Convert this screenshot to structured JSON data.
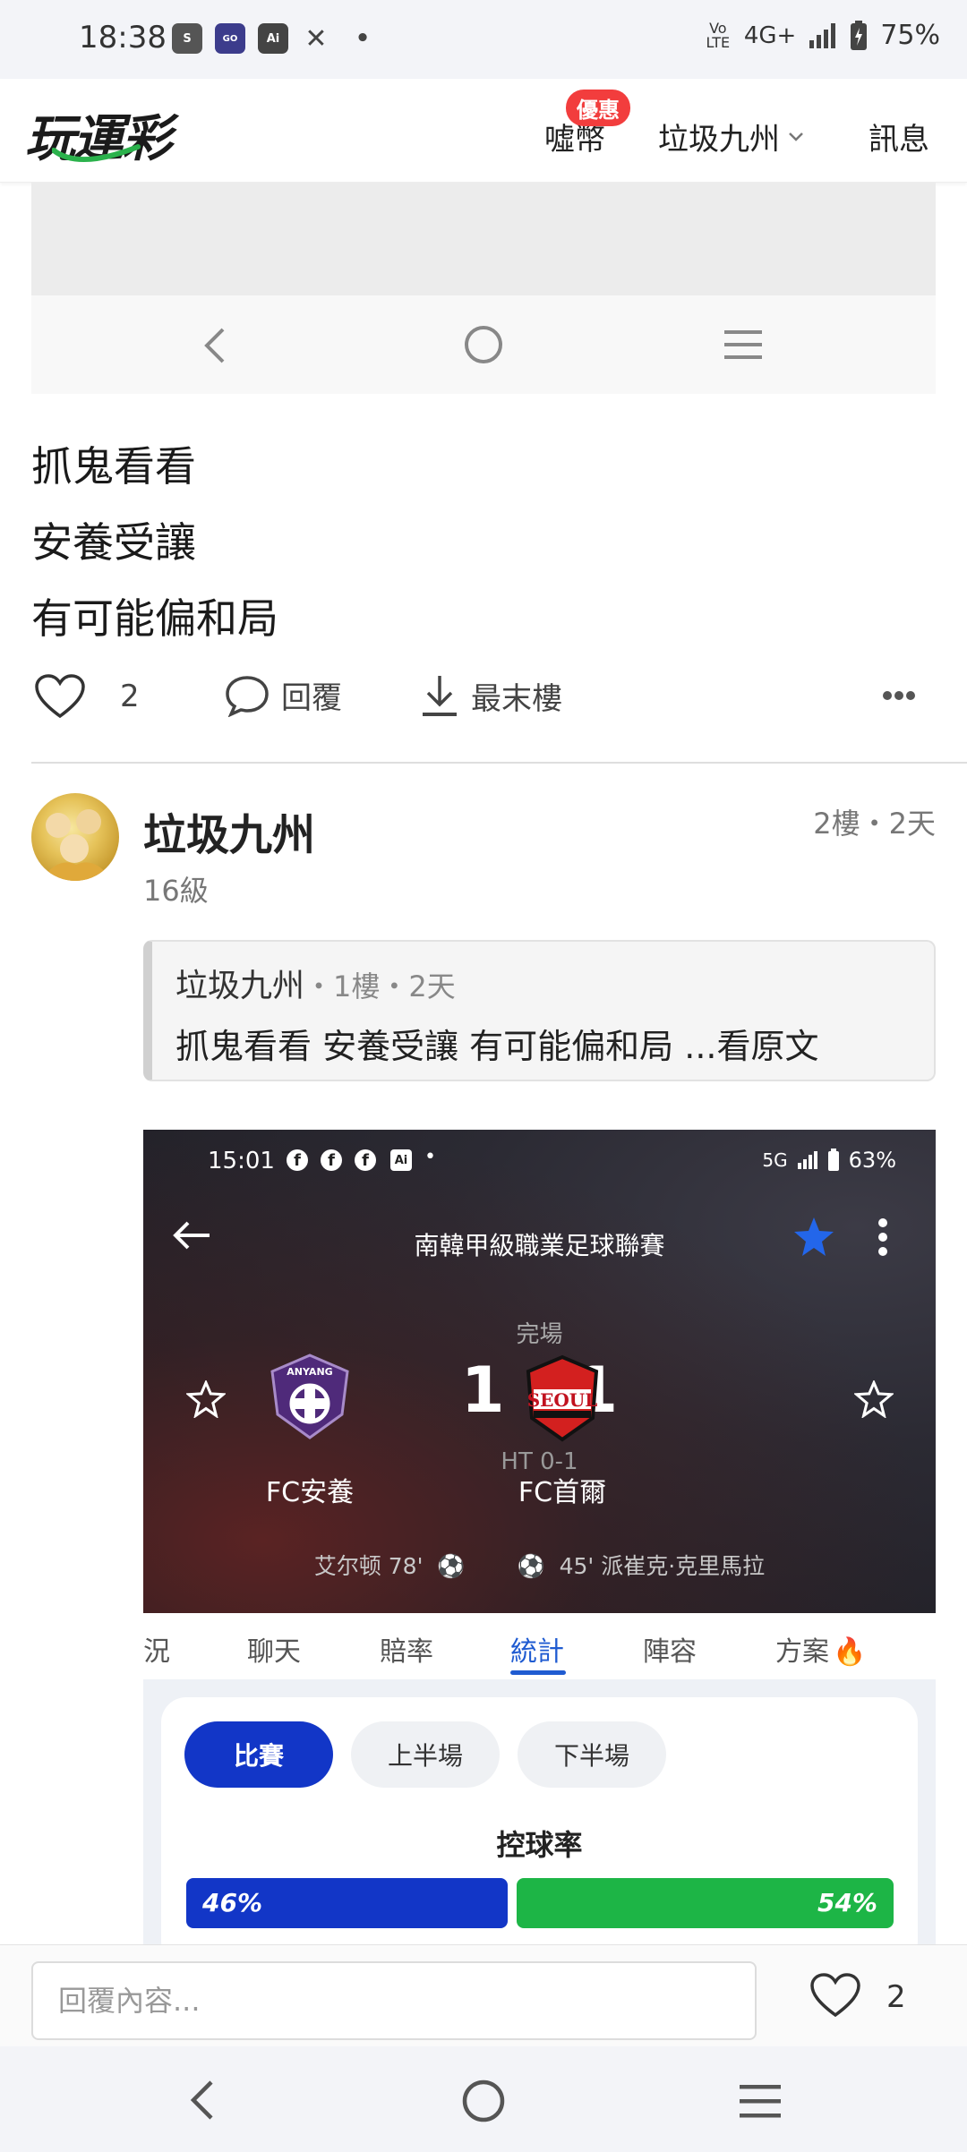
{
  "status_bar": {
    "time": "18:38",
    "battery": "75%",
    "network": "4G+",
    "volte": "Vo LTE",
    "icons": [
      "shopee-icon",
      "happy-go-icon",
      "ai-icon",
      "x-icon",
      "dot-icon"
    ]
  },
  "header": {
    "logo": "玩運彩",
    "nav": [
      {
        "label": "噓幣",
        "badge": "優惠"
      },
      {
        "label": "垃圾九州"
      },
      {
        "label": "訊息"
      }
    ]
  },
  "post": {
    "lines": [
      "抓鬼看看",
      "安養受讓",
      "有可能偏和局"
    ],
    "actions": {
      "like_count": "2",
      "reply": "回覆",
      "last_floor": "最末樓"
    }
  },
  "reply_post": {
    "user": "垃圾九州",
    "level": "16級",
    "floor_time": "2樓・2天",
    "quote": {
      "user": "垃圾九州",
      "meta": "・1樓・2天",
      "text": "抓鬼看看 安養受讓 有可能偏和局 ...看原文"
    }
  },
  "embedded_screenshot": {
    "status_time": "15:01",
    "status_battery": "63%",
    "status_net": "5G",
    "league": "南韓甲級職業足球聯賽",
    "state": "完場",
    "score": "1 - 1",
    "half_time": "HT 0-1",
    "home_team": "FC安養",
    "home_logo_text": "ANYANG",
    "away_team": "FC首爾",
    "away_logo_text": "SEOUL",
    "home_scorer": "艾尔顿 78'",
    "away_scorer": "45' 派崔克·克里馬拉",
    "tabs": [
      "況",
      "聊天",
      "賠率",
      "統計",
      "陣容",
      "方案"
    ],
    "active_tab": "統計",
    "period_buttons": [
      "比賽",
      "上半場",
      "下半場"
    ],
    "stat_label": "控球率",
    "possession": {
      "home": "46%",
      "away": "54%",
      "home_value": 46,
      "away_value": 54
    },
    "colors": {
      "home": "#1236c7",
      "away": "#1db546",
      "active": "#1f5bd1"
    }
  },
  "reply_bar": {
    "placeholder": "回覆內容...",
    "like_count": "2"
  }
}
